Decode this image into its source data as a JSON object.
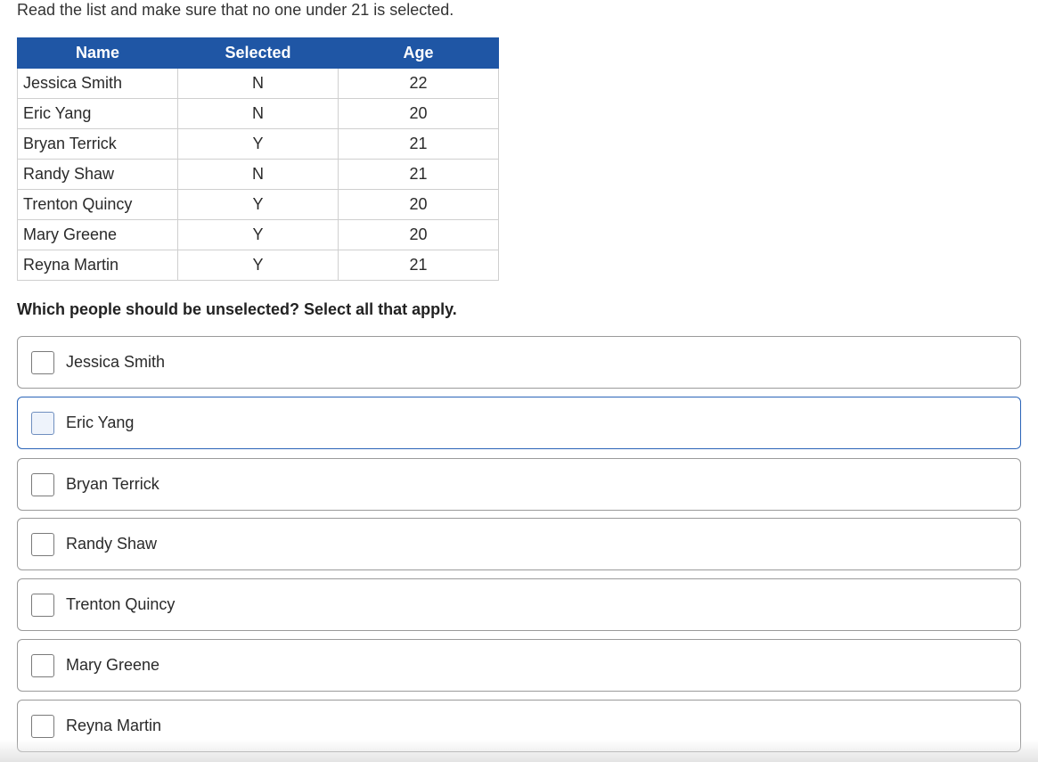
{
  "instruction": "Read the list and make sure that no one under 21 is selected.",
  "table": {
    "headers": {
      "name": "Name",
      "selected": "Selected",
      "age": "Age"
    },
    "rows": [
      {
        "name": "Jessica Smith",
        "selected": "N",
        "age": "22"
      },
      {
        "name": "Eric Yang",
        "selected": "N",
        "age": "20"
      },
      {
        "name": "Bryan Terrick",
        "selected": "Y",
        "age": "21"
      },
      {
        "name": "Randy Shaw",
        "selected": "N",
        "age": "21"
      },
      {
        "name": "Trenton Quincy",
        "selected": "Y",
        "age": "20"
      },
      {
        "name": "Mary Greene",
        "selected": "Y",
        "age": "20"
      },
      {
        "name": "Reyna Martin",
        "selected": "Y",
        "age": "21"
      }
    ]
  },
  "question": "Which people should be unselected? Select all that apply.",
  "options": [
    {
      "label": "Jessica Smith",
      "checked": false
    },
    {
      "label": "Eric Yang",
      "checked": false,
      "focused": true
    },
    {
      "label": "Bryan Terrick",
      "checked": false
    },
    {
      "label": "Randy Shaw",
      "checked": false
    },
    {
      "label": "Trenton Quincy",
      "checked": false
    },
    {
      "label": "Mary Greene",
      "checked": false
    },
    {
      "label": "Reyna Martin",
      "checked": false
    }
  ],
  "colors": {
    "header_blue": "#1f56a5",
    "focus_border": "#2a64b8"
  }
}
